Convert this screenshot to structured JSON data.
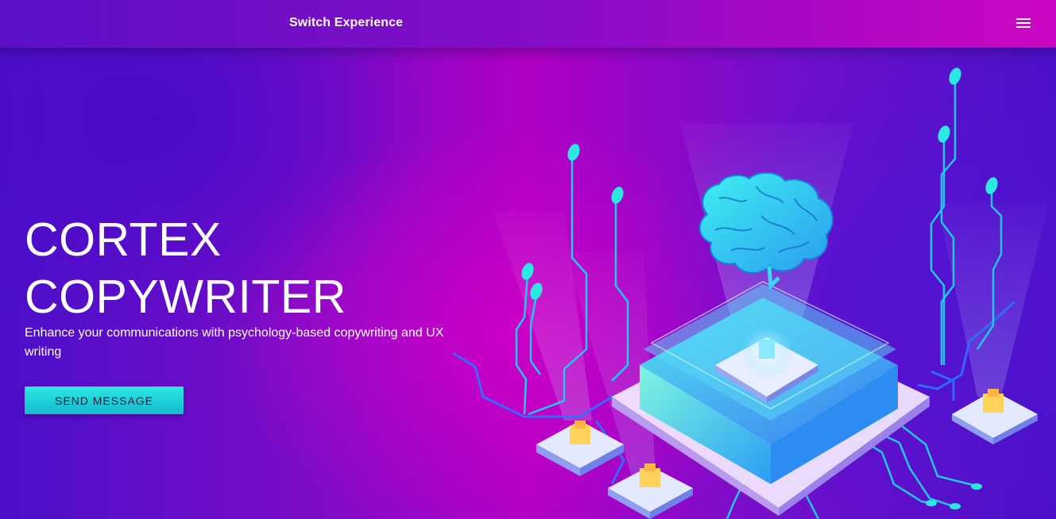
{
  "header": {
    "brand": "Switch Experience",
    "menu_icon": "hamburger-menu-icon"
  },
  "hero": {
    "title_line1": "CORTEX",
    "title_line2": "COPYWRITER",
    "subtitle": "Enhance your communications with psychology-based copywriting and UX writing",
    "cta_label": "SEND MESSAGE"
  },
  "illustration": {
    "icon": "ai-brain-chip-icon"
  },
  "colors": {
    "accent": "#1fd3d8",
    "brand_magenta": "#cc06c2",
    "brand_violet": "#4a0fc8",
    "text": "#ffffff"
  }
}
